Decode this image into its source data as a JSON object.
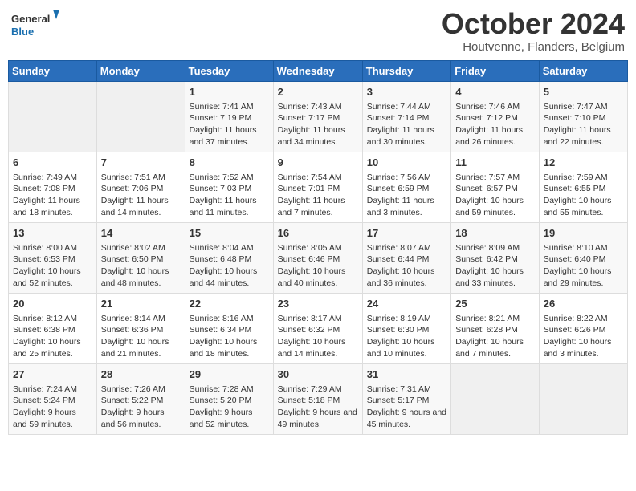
{
  "header": {
    "logo_general": "General",
    "logo_blue": "Blue",
    "month": "October 2024",
    "location": "Houtvenne, Flanders, Belgium"
  },
  "days_of_week": [
    "Sunday",
    "Monday",
    "Tuesday",
    "Wednesday",
    "Thursday",
    "Friday",
    "Saturday"
  ],
  "weeks": [
    [
      {
        "day": "",
        "info": ""
      },
      {
        "day": "",
        "info": ""
      },
      {
        "day": "1",
        "info": "Sunrise: 7:41 AM\nSunset: 7:19 PM\nDaylight: 11 hours and 37 minutes."
      },
      {
        "day": "2",
        "info": "Sunrise: 7:43 AM\nSunset: 7:17 PM\nDaylight: 11 hours and 34 minutes."
      },
      {
        "day": "3",
        "info": "Sunrise: 7:44 AM\nSunset: 7:14 PM\nDaylight: 11 hours and 30 minutes."
      },
      {
        "day": "4",
        "info": "Sunrise: 7:46 AM\nSunset: 7:12 PM\nDaylight: 11 hours and 26 minutes."
      },
      {
        "day": "5",
        "info": "Sunrise: 7:47 AM\nSunset: 7:10 PM\nDaylight: 11 hours and 22 minutes."
      }
    ],
    [
      {
        "day": "6",
        "info": "Sunrise: 7:49 AM\nSunset: 7:08 PM\nDaylight: 11 hours and 18 minutes."
      },
      {
        "day": "7",
        "info": "Sunrise: 7:51 AM\nSunset: 7:06 PM\nDaylight: 11 hours and 14 minutes."
      },
      {
        "day": "8",
        "info": "Sunrise: 7:52 AM\nSunset: 7:03 PM\nDaylight: 11 hours and 11 minutes."
      },
      {
        "day": "9",
        "info": "Sunrise: 7:54 AM\nSunset: 7:01 PM\nDaylight: 11 hours and 7 minutes."
      },
      {
        "day": "10",
        "info": "Sunrise: 7:56 AM\nSunset: 6:59 PM\nDaylight: 11 hours and 3 minutes."
      },
      {
        "day": "11",
        "info": "Sunrise: 7:57 AM\nSunset: 6:57 PM\nDaylight: 10 hours and 59 minutes."
      },
      {
        "day": "12",
        "info": "Sunrise: 7:59 AM\nSunset: 6:55 PM\nDaylight: 10 hours and 55 minutes."
      }
    ],
    [
      {
        "day": "13",
        "info": "Sunrise: 8:00 AM\nSunset: 6:53 PM\nDaylight: 10 hours and 52 minutes."
      },
      {
        "day": "14",
        "info": "Sunrise: 8:02 AM\nSunset: 6:50 PM\nDaylight: 10 hours and 48 minutes."
      },
      {
        "day": "15",
        "info": "Sunrise: 8:04 AM\nSunset: 6:48 PM\nDaylight: 10 hours and 44 minutes."
      },
      {
        "day": "16",
        "info": "Sunrise: 8:05 AM\nSunset: 6:46 PM\nDaylight: 10 hours and 40 minutes."
      },
      {
        "day": "17",
        "info": "Sunrise: 8:07 AM\nSunset: 6:44 PM\nDaylight: 10 hours and 36 minutes."
      },
      {
        "day": "18",
        "info": "Sunrise: 8:09 AM\nSunset: 6:42 PM\nDaylight: 10 hours and 33 minutes."
      },
      {
        "day": "19",
        "info": "Sunrise: 8:10 AM\nSunset: 6:40 PM\nDaylight: 10 hours and 29 minutes."
      }
    ],
    [
      {
        "day": "20",
        "info": "Sunrise: 8:12 AM\nSunset: 6:38 PM\nDaylight: 10 hours and 25 minutes."
      },
      {
        "day": "21",
        "info": "Sunrise: 8:14 AM\nSunset: 6:36 PM\nDaylight: 10 hours and 21 minutes."
      },
      {
        "day": "22",
        "info": "Sunrise: 8:16 AM\nSunset: 6:34 PM\nDaylight: 10 hours and 18 minutes."
      },
      {
        "day": "23",
        "info": "Sunrise: 8:17 AM\nSunset: 6:32 PM\nDaylight: 10 hours and 14 minutes."
      },
      {
        "day": "24",
        "info": "Sunrise: 8:19 AM\nSunset: 6:30 PM\nDaylight: 10 hours and 10 minutes."
      },
      {
        "day": "25",
        "info": "Sunrise: 8:21 AM\nSunset: 6:28 PM\nDaylight: 10 hours and 7 minutes."
      },
      {
        "day": "26",
        "info": "Sunrise: 8:22 AM\nSunset: 6:26 PM\nDaylight: 10 hours and 3 minutes."
      }
    ],
    [
      {
        "day": "27",
        "info": "Sunrise: 7:24 AM\nSunset: 5:24 PM\nDaylight: 9 hours and 59 minutes."
      },
      {
        "day": "28",
        "info": "Sunrise: 7:26 AM\nSunset: 5:22 PM\nDaylight: 9 hours and 56 minutes."
      },
      {
        "day": "29",
        "info": "Sunrise: 7:28 AM\nSunset: 5:20 PM\nDaylight: 9 hours and 52 minutes."
      },
      {
        "day": "30",
        "info": "Sunrise: 7:29 AM\nSunset: 5:18 PM\nDaylight: 9 hours and 49 minutes."
      },
      {
        "day": "31",
        "info": "Sunrise: 7:31 AM\nSunset: 5:17 PM\nDaylight: 9 hours and 45 minutes."
      },
      {
        "day": "",
        "info": ""
      },
      {
        "day": "",
        "info": ""
      }
    ]
  ]
}
